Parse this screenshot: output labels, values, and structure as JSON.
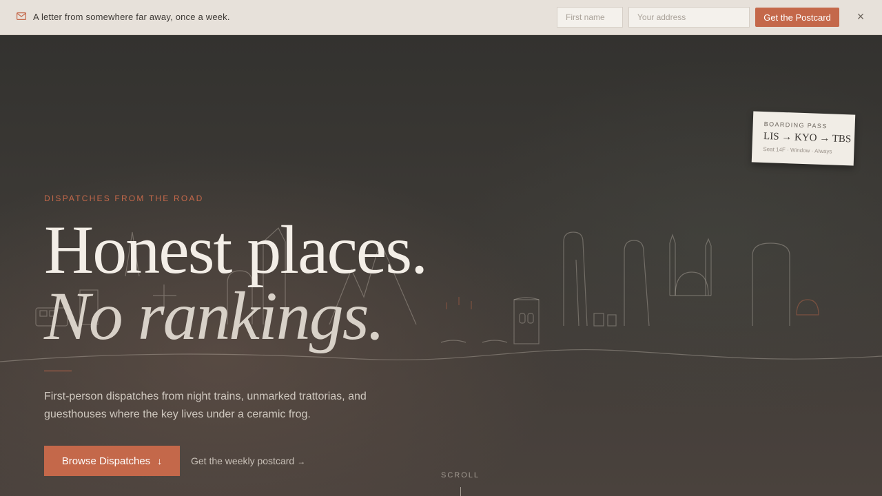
{
  "banner": {
    "message": "A letter from somewhere far away, once a week.",
    "first_name_placeholder": "First name",
    "address_placeholder": "Your address",
    "cta_label": "Get the Postcard",
    "close_label": "×",
    "mail_icon": "mail-icon"
  },
  "hero": {
    "eyebrow": "DISPATCHES FROM THE ROAD",
    "headline_line1": "Honest places.",
    "headline_line2": "No rankings.",
    "lede": "First-person dispatches from night trains, unmarked trattorias, and guesthouses where the key lives under a ceramic frog.",
    "browse_label": "Browse Dispatches",
    "browse_icon": "↓",
    "weekly_label": "Get the weekly postcard",
    "weekly_arrow": "→",
    "scroll_label": "SCROLL"
  },
  "boarding_pass": {
    "label": "BOARDING PASS",
    "route": "LIS → KYO → TBS",
    "seat": "Seat 14F · Window · Always"
  },
  "colors": {
    "accent": "#c4684a",
    "banner_bg": "#e7e1da",
    "headline": "#f3eee7"
  }
}
